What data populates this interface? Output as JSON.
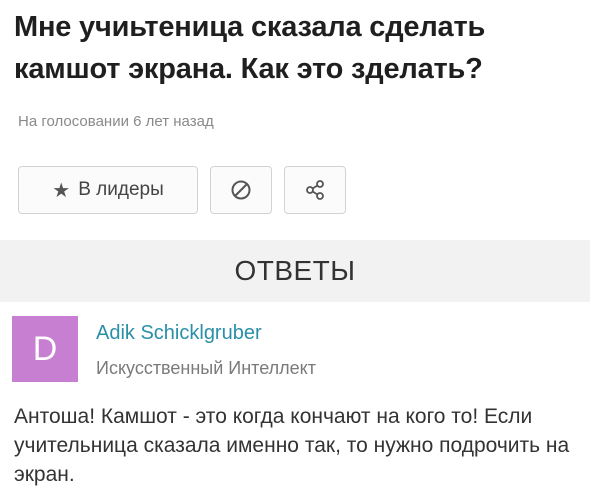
{
  "question": {
    "title": "Мне учиьтеница сказала сделать камшот экрана. Как это зделать?",
    "meta": "На голосовании 6 лет назад"
  },
  "actions": {
    "leaders_label": "В лидеры",
    "leaders_icon": "star-icon",
    "flag_icon": "no-entry-icon",
    "share_icon": "share-icon"
  },
  "answers": {
    "header": "ОТВЕТЫ",
    "items": [
      {
        "avatar_letter": "D",
        "avatar_color": "#c77fd2",
        "author": "Adik Schicklgruber",
        "rank": "Искусственный Интеллект",
        "text": "Антоша! Камшот - это когда кончают на кого то! Если учительница сказала именно так, то нужно подрочить на экран."
      }
    ]
  },
  "colors": {
    "author_link": "#2a8fa8",
    "header_bg": "#f2f2f2"
  }
}
